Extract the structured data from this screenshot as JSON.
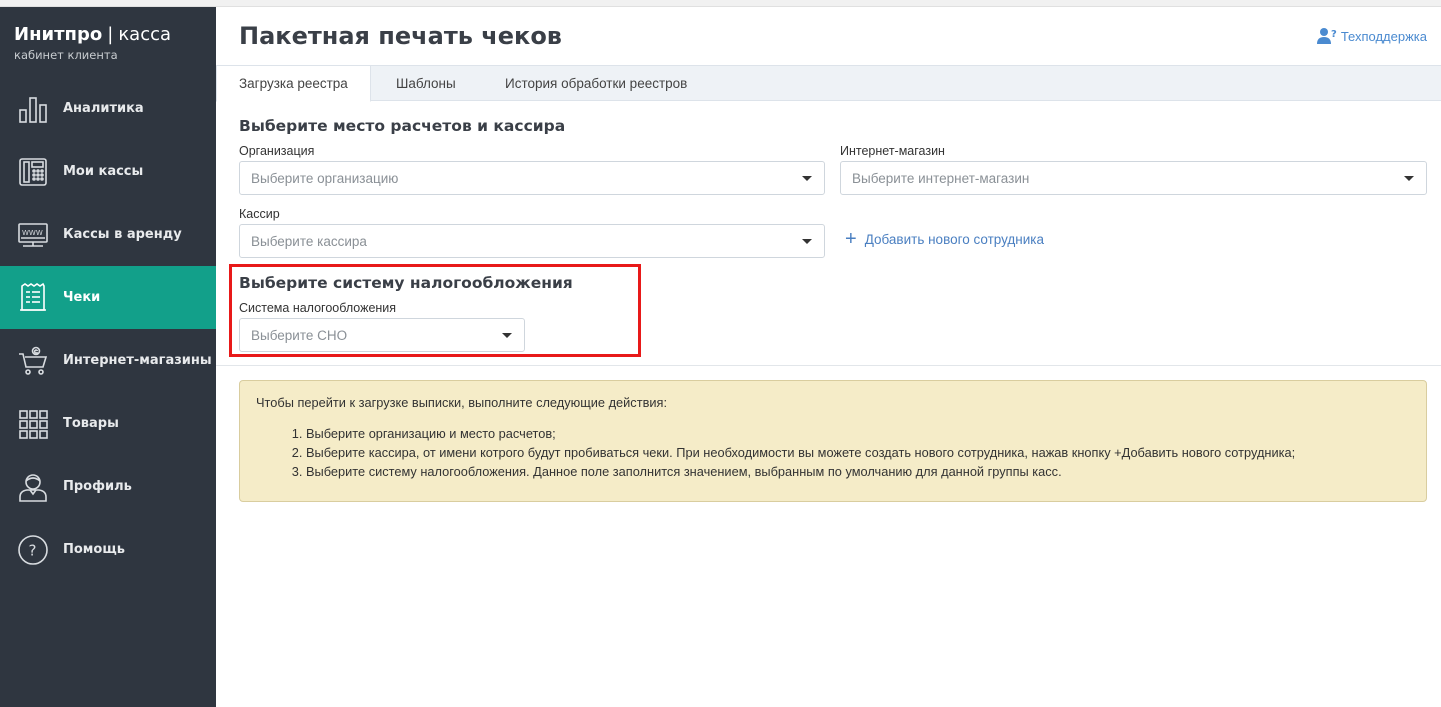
{
  "sidebar": {
    "logo_brand": "Инитпро",
    "logo_sep": "|",
    "logo_product": "касса",
    "logo_sub": "кабинет клиента",
    "items": [
      {
        "label": "Аналитика",
        "icon": "analytics-icon",
        "active": false
      },
      {
        "label": "Мои кассы",
        "icon": "cash-register-icon",
        "active": false
      },
      {
        "label": "Кассы в аренду",
        "icon": "www-terminal-icon",
        "active": false
      },
      {
        "label": "Чеки",
        "icon": "receipt-icon",
        "active": true
      },
      {
        "label": "Интернет-магазины",
        "icon": "shopping-cart-icon",
        "active": false
      },
      {
        "label": "Товары",
        "icon": "grid-icon",
        "active": false
      },
      {
        "label": "Профиль",
        "icon": "user-icon",
        "active": false
      },
      {
        "label": "Помощь",
        "icon": "help-icon",
        "active": false
      }
    ]
  },
  "header": {
    "title": "Пакетная печать чеков",
    "support_label": "Техподдержка"
  },
  "tabs": [
    {
      "label": "Загрузка реестра",
      "active": true
    },
    {
      "label": "Шаблоны",
      "active": false
    },
    {
      "label": "История обработки реестров",
      "active": false
    }
  ],
  "section1": {
    "title": "Выберите место расчетов и кассира",
    "org_label": "Организация",
    "org_placeholder": "Выберите организацию",
    "shop_label": "Интернет-магазин",
    "shop_placeholder": "Выберите интернет-магазин",
    "cashier_label": "Кассир",
    "cashier_placeholder": "Выберите кассира",
    "add_employee": "Добавить нового сотрудника"
  },
  "section2": {
    "title": "Выберите систему налогообложения",
    "tax_label": "Система налогообложения",
    "tax_placeholder": "Выберите СНО"
  },
  "info": {
    "intro": "Чтобы перейти к загрузке выписки, выполните следующие действия:",
    "steps": [
      "Выберите организацию и место расчетов;",
      "Выберите кассира, от имени котрого будут пробиваться чеки. При необходимости вы можете создать нового сотрудника, нажав кнопку +Добавить нового сотрудника;",
      "Выберите систему налогообложения. Данное поле заполнится значением, выбранным по умолчанию для данной группы касс."
    ]
  },
  "colors": {
    "sidebar_bg": "#2f3640",
    "active_item": "#12a08a",
    "link": "#4a7fc1",
    "highlight": "#e81919",
    "info_bg": "#f5ecc8"
  }
}
